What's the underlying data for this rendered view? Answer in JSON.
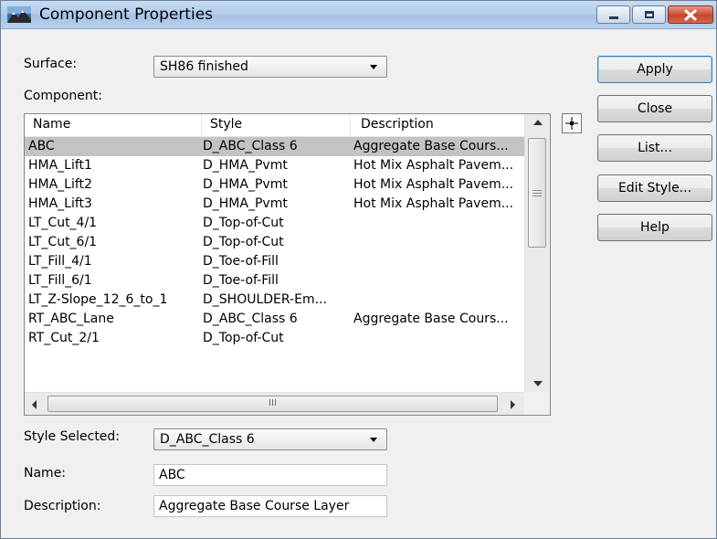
{
  "window": {
    "title": "Component Properties",
    "icon": "terrain-icon",
    "controls": [
      "minimize-icon",
      "maximize-icon",
      "close-icon"
    ]
  },
  "surface": {
    "label": "Surface:",
    "value": "SH86 finished"
  },
  "component": {
    "label": "Component:",
    "columns": [
      "Name",
      "Style",
      "Description"
    ],
    "rows": [
      [
        "ABC",
        "D_ABC_Class 6",
        "Aggregate Base Cours..."
      ],
      [
        "HMA_Lift1",
        "D_HMA_Pvmt",
        "Hot Mix Asphalt Pavem..."
      ],
      [
        "HMA_Lift2",
        "D_HMA_Pvmt",
        "Hot Mix Asphalt Pavem..."
      ],
      [
        "HMA_Lift3",
        "D_HMA_Pvmt",
        "Hot Mix Asphalt Pavem..."
      ],
      [
        "LT_Cut_4/1",
        "D_Top-of-Cut",
        ""
      ],
      [
        "LT_Cut_6/1",
        "D_Top-of-Cut",
        ""
      ],
      [
        "LT_Fill_4/1",
        "D_Toe-of-Fill",
        ""
      ],
      [
        "LT_Fill_6/1",
        "D_Toe-of-Fill",
        ""
      ],
      [
        "LT_Z-Slope_12_6_to_1",
        "D_SHOULDER-Em...",
        ""
      ],
      [
        "RT_ABC_Lane",
        "D_ABC_Class 6",
        "Aggregate Base Cours..."
      ],
      [
        "RT_Cut_2/1",
        "D_Top-of-Cut",
        ""
      ]
    ],
    "selected_row": "ABC",
    "hscroll_marker": "III"
  },
  "buttons": {
    "apply": "Apply",
    "close": "Close",
    "list": "List...",
    "edit_style": "Edit Style...",
    "help": "Help"
  },
  "style_selected": {
    "label": "Style Selected:",
    "value": "D_ABC_Class 6"
  },
  "name_field": {
    "label": "Name:",
    "value": "ABC"
  },
  "description_field": {
    "label": "Description:",
    "value": "Aggregate Base Course Layer"
  },
  "colors": {
    "selection": "#c3c3c3",
    "title_bar": "#b4cde9",
    "close_button": "#c7462a"
  }
}
